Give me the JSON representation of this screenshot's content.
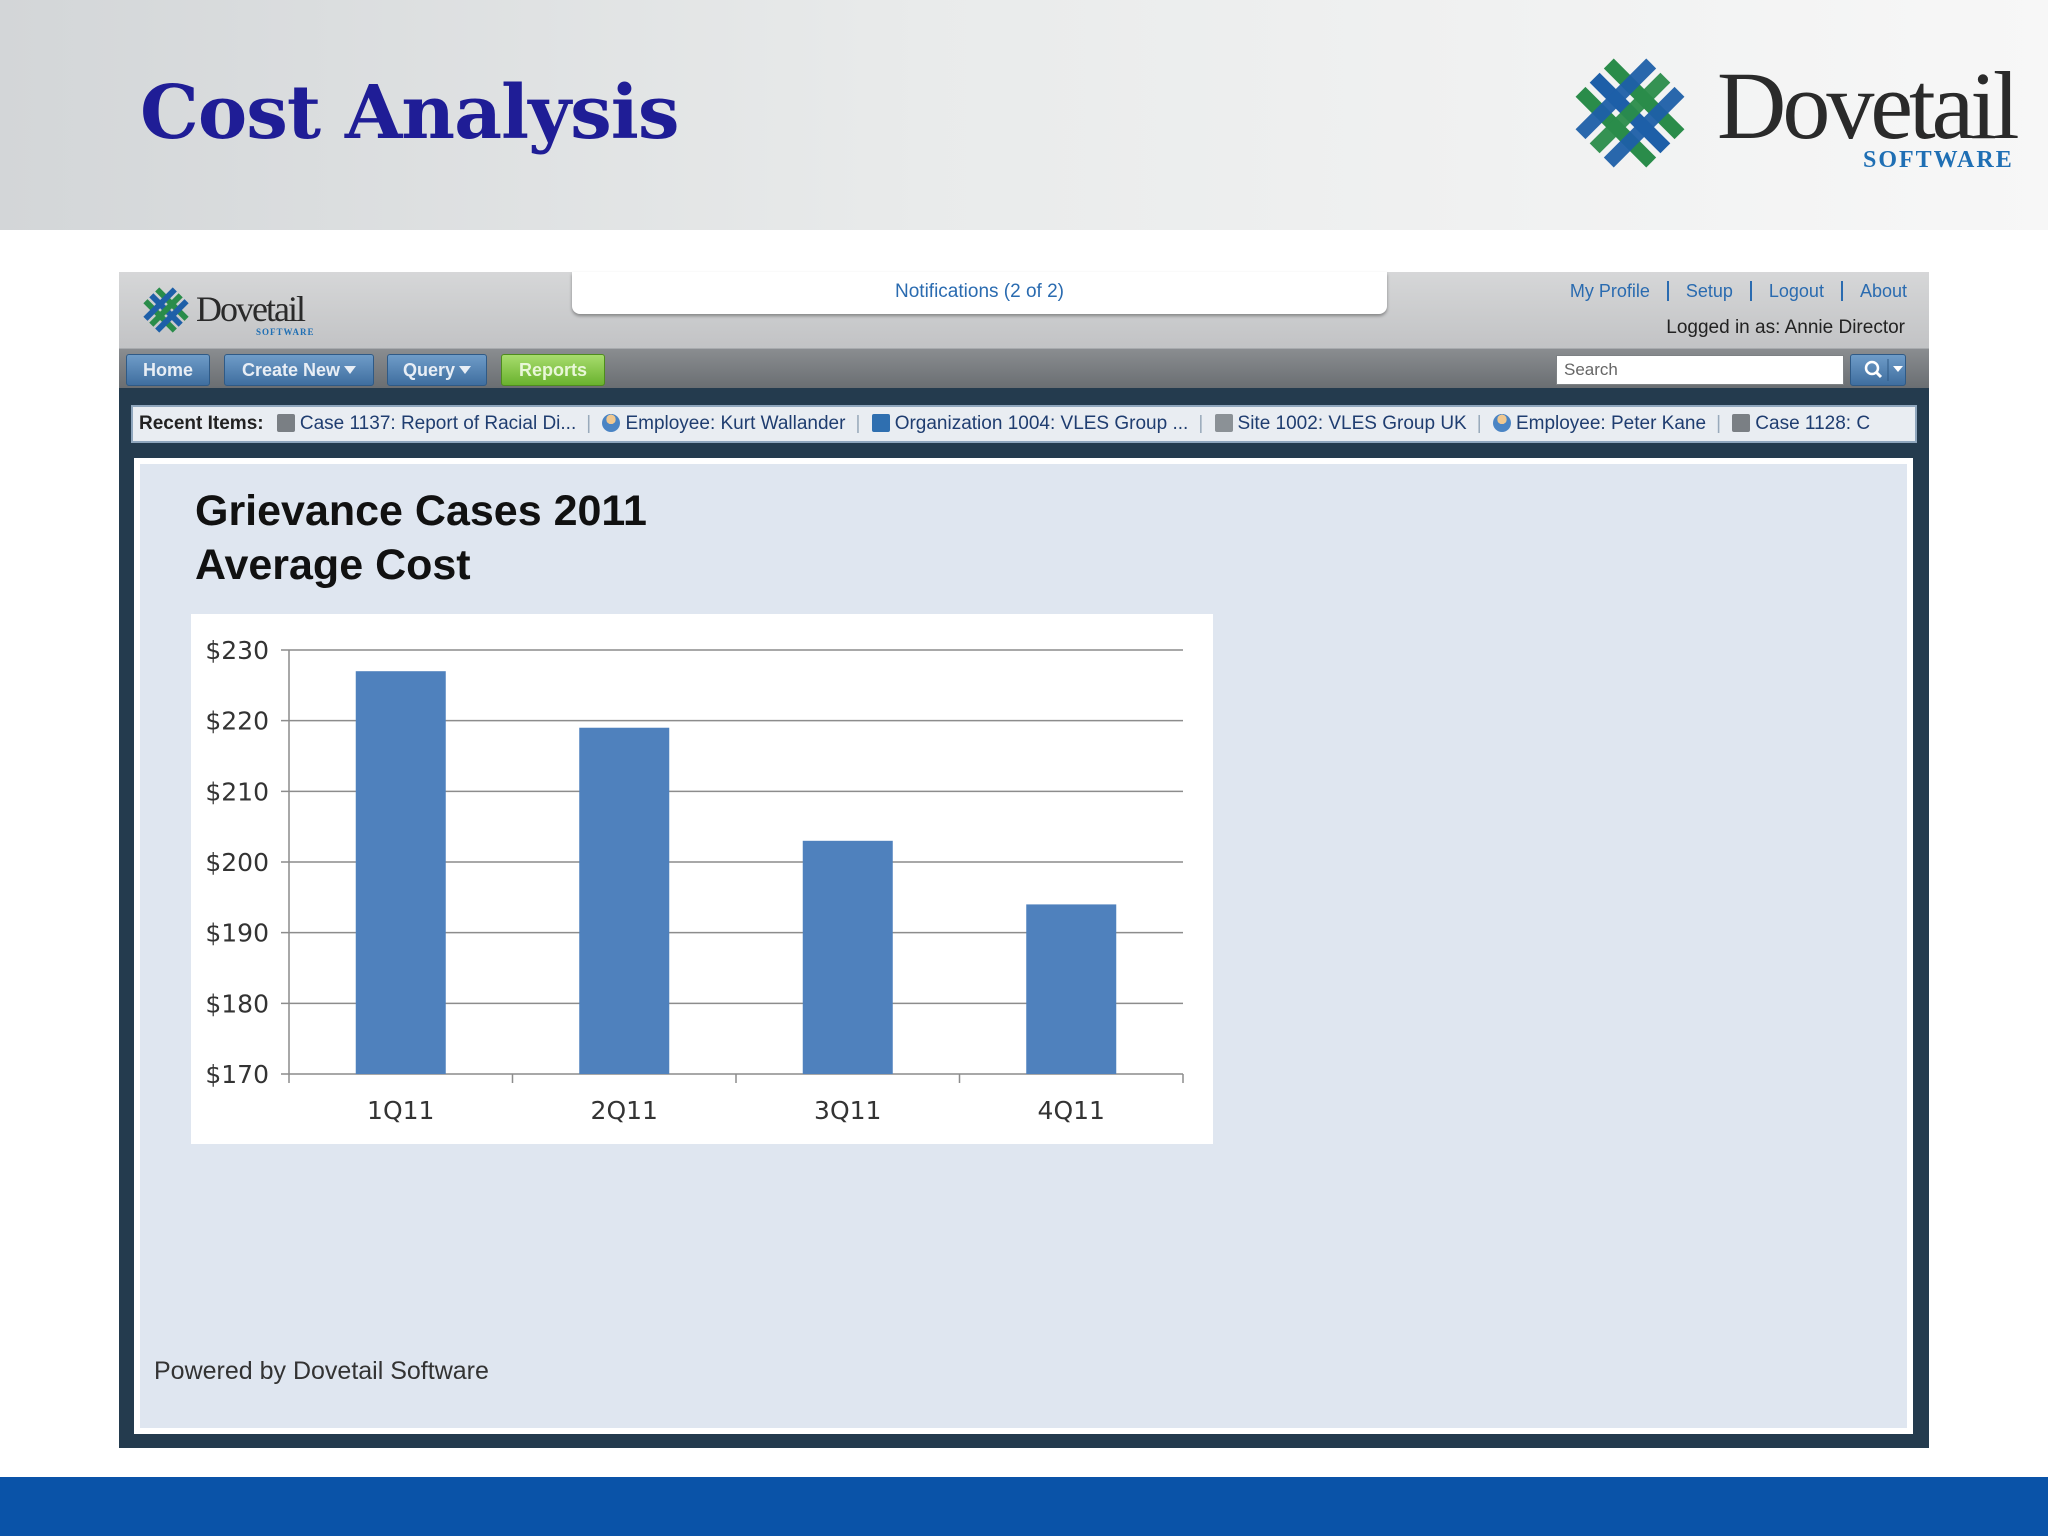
{
  "slide": {
    "title": "Cost Analysis",
    "logo_word": "Dovetail",
    "logo_sub": "SOFTWARE"
  },
  "app": {
    "logo_word": "Dovetail",
    "logo_sub": "SOFTWARE",
    "notifications": "Notifications (2 of 2)",
    "top_links": [
      "My Profile",
      "Setup",
      "Logout",
      "About"
    ],
    "logged_in": "Logged in as: Annie Director",
    "nav": {
      "home": "Home",
      "create_new": "Create New",
      "query": "Query",
      "reports": "Reports"
    },
    "search_placeholder": "Search",
    "recent": {
      "label": "Recent Items:",
      "items": [
        {
          "icon": "case-icon",
          "text": "Case 1137: Report of Racial Di..."
        },
        {
          "icon": "employee-icon",
          "text": "Employee: Kurt Wallander"
        },
        {
          "icon": "organization-icon",
          "text": "Organization 1004: VLES Group ..."
        },
        {
          "icon": "site-icon",
          "text": "Site 1002: VLES Group UK"
        },
        {
          "icon": "employee-icon",
          "text": "Employee: Peter Kane"
        },
        {
          "icon": "case-icon",
          "text": "Case 1128: C"
        }
      ]
    },
    "report_title_line1": "Grievance Cases 2011",
    "report_title_line2": "Average Cost",
    "powered_by": "Powered by Dovetail Software"
  },
  "chart_data": {
    "type": "bar",
    "categories": [
      "1Q11",
      "2Q11",
      "3Q11",
      "4Q11"
    ],
    "values": [
      227,
      219,
      203,
      194
    ],
    "ylim": [
      170,
      230
    ],
    "yticks": [
      230,
      220,
      210,
      200,
      190,
      180,
      170
    ],
    "ytick_labels": [
      "$230",
      "$220",
      "$210",
      "$200",
      "$190",
      "$180",
      "$170"
    ],
    "grid": true,
    "bar_color": "#4f81bd"
  }
}
